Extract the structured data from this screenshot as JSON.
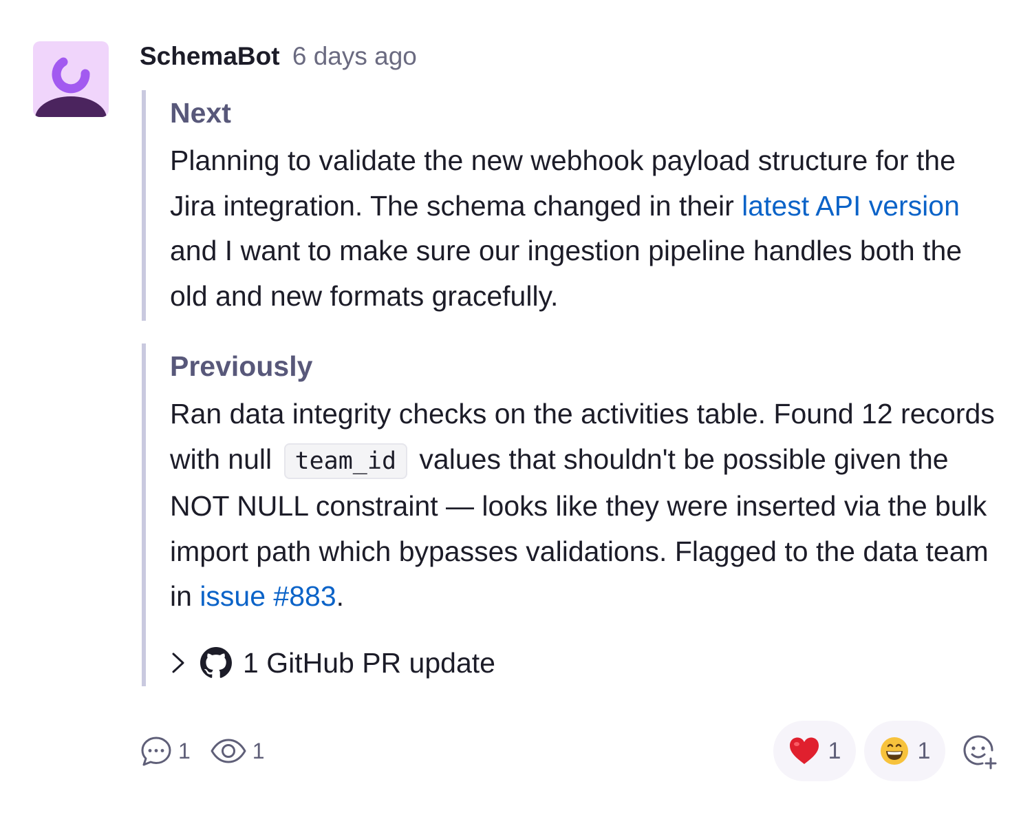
{
  "post": {
    "author": "SchemaBot",
    "time": "6 days ago",
    "avatar_icon": "bot-avatar-icon"
  },
  "next": {
    "title": "Next",
    "text_before_link": "Planning to validate the new webhook payload structure for the Jira integration. The schema changed in their ",
    "link_text": "latest API version",
    "text_after_link": " and I want to make sure our ingestion pipeline han­dles both the old and new formats gracefully."
  },
  "previously": {
    "title": "Previously",
    "text_before_code": "Ran data integrity checks on the activities table. Found 12 records with null ",
    "code": "team_id",
    "text_after_code": " values that shouldn't be possi­ble given the NOT NULL constraint — looks like they were inserted via the bulk import path which bypasses valida­tions. Flagged to the data team in ",
    "link_text": "issue #883",
    "text_end": "."
  },
  "pr_update": {
    "label": "1 GitHub PR update",
    "icon": "github-icon"
  },
  "footer": {
    "comments_count": "1",
    "views_count": "1",
    "reactions": [
      {
        "emoji": "heart",
        "count": "1",
        "color": "#e0202e"
      },
      {
        "emoji": "grinning-face",
        "count": "1",
        "color": "#f7c23c"
      }
    ]
  },
  "colors": {
    "link": "#0b63c8",
    "section_title": "#58587a",
    "quote_border": "#c9c9df",
    "avatar_bg": "#f0d5fb",
    "avatar_accent": "#a25af0",
    "avatar_body": "#4b245e"
  }
}
